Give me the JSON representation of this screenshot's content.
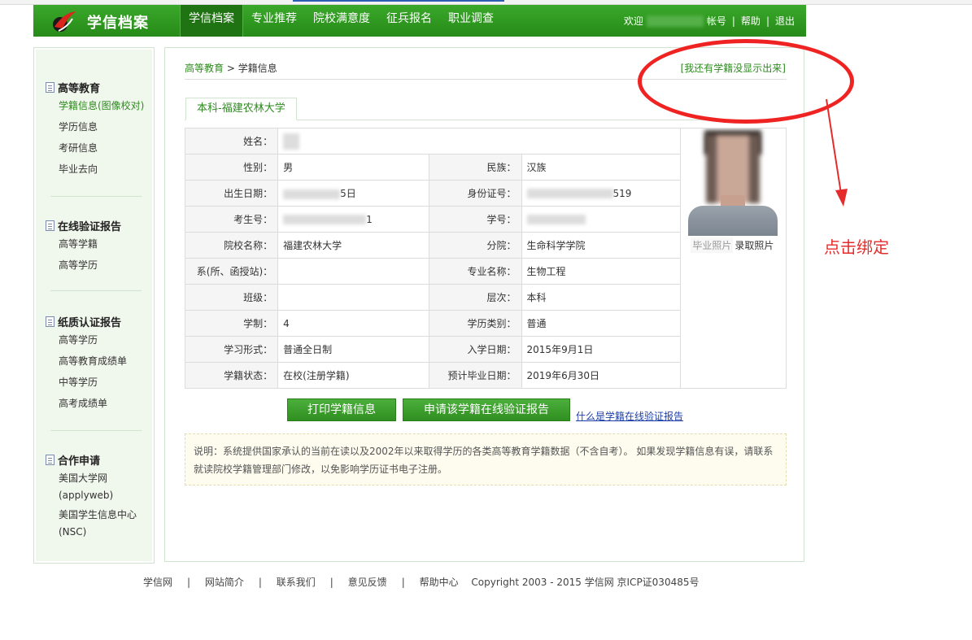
{
  "header": {
    "logo_text": "学信档案",
    "nav": [
      "学信档案",
      "专业推荐",
      "院校满意度",
      "征兵报名",
      "职业调查"
    ],
    "welcome": "欢迎",
    "account": "帐号",
    "help": "帮助",
    "logout": "退出",
    "sep": "|"
  },
  "sidebar": {
    "groups": [
      {
        "title": "高等教育",
        "items": [
          "学籍信息(图像校对)",
          "学历信息",
          "考研信息",
          "毕业去向"
        ]
      },
      {
        "title": "在线验证报告",
        "items": [
          "高等学籍",
          "高等学历"
        ]
      },
      {
        "title": "纸质认证报告",
        "items": [
          "高等学历",
          "高等教育成绩单",
          "中等学历",
          "高考成绩单"
        ]
      },
      {
        "title": "合作申请",
        "items": [
          "美国大学网(applyweb)",
          "美国学生信息中心(NSC)"
        ]
      }
    ]
  },
  "main": {
    "breadcrumb": {
      "parent": "高等教育",
      "gt": ">",
      "current": "学籍信息"
    },
    "missing_link": "[我还有学籍没显示出来]",
    "school_tab": "本科-福建农林大学",
    "fields": {
      "name_label": "姓名：",
      "gender_label": "性别：",
      "gender": "男",
      "ethnicity_label": "民族：",
      "ethnicity": "汉族",
      "birth_label": "出生日期：",
      "birth_visible": "5日",
      "id_label": "身份证号：",
      "id_visible": "519",
      "exam_no_label": "考生号：",
      "exam_no_visible": "1",
      "student_no_label": "学号：",
      "school_label": "院校名称：",
      "school": "福建农林大学",
      "branch_label": "分院：",
      "branch": "生命科学学院",
      "dept_label": "系(所、函授站)：",
      "dept": "",
      "major_label": "专业名称：",
      "major": "生物工程",
      "class_label": "班级：",
      "class": "",
      "level_label": "层次：",
      "level": "本科",
      "duration_label": "学制：",
      "duration": "4",
      "edu_type_label": "学历类别：",
      "edu_type": "普通",
      "study_form_label": "学习形式：",
      "study_form": "普通全日制",
      "enroll_label": "入学日期：",
      "enroll": "2015年9月1日",
      "status_label": "学籍状态：",
      "status": "在校(注册学籍)",
      "grad_label": "预计毕业日期：",
      "grad": "2019年6月30日"
    },
    "photo": {
      "grad_label": "毕业照片",
      "enroll_label": "录取照片"
    },
    "buttons": {
      "print": "打印学籍信息",
      "apply": "申请该学籍在线验证报告"
    },
    "what_link": "什么是学籍在线验证报告",
    "note": "说明：系统提供国家承认的当前在读以及2002年以来取得学历的各类高等教育学籍数据（不含自考）。 如果发现学籍信息有误，请联系就读院校学籍管理部门修改，以免影响学历证书电子注册。"
  },
  "footer": {
    "links": [
      "学信网",
      "网站简介",
      "联系我们",
      "意见反馈",
      "帮助中心"
    ],
    "sep": "|",
    "copyright": "Copyright 2003 - 2015  学信网  京ICP证030485号"
  },
  "annotation": {
    "text": "点击绑定",
    "color": "#e42c2c"
  }
}
